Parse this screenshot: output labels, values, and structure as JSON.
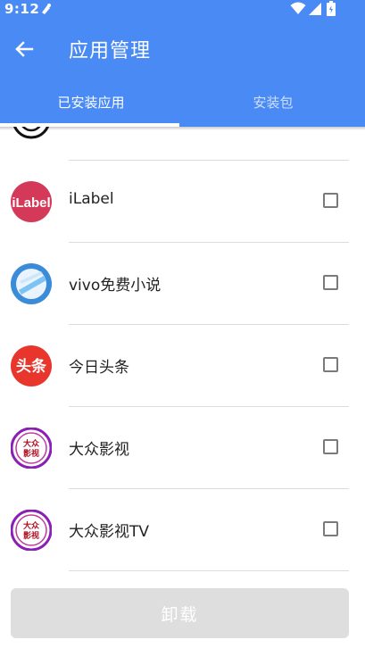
{
  "status_bar": {
    "time": "9:12"
  },
  "header": {
    "title": "应用管理",
    "tabs": [
      {
        "label": "已安装应用",
        "active": true
      },
      {
        "label": "安装包",
        "active": false
      }
    ]
  },
  "apps": [
    {
      "name": "",
      "icon": "ring-app-icon",
      "checked": false
    },
    {
      "name": "iLabel",
      "icon": "ilabel-app-icon",
      "icon_text": "iLabel",
      "checked": false
    },
    {
      "name": "vivo免费小说",
      "icon": "vivo-novel-app-icon",
      "checked": false
    },
    {
      "name": "今日头条",
      "icon": "toutiao-app-icon",
      "icon_text": "头条",
      "checked": false
    },
    {
      "name": "大众影视",
      "icon": "dazhong-app-icon",
      "icon_text": "大众\n影视",
      "checked": false
    },
    {
      "name": "大众影视TV",
      "icon": "dazhong-tv-app-icon",
      "icon_text": "大众\n影视",
      "checked": false
    }
  ],
  "footer": {
    "uninstall_label": "卸载"
  },
  "colors": {
    "primary": "#4a8af4",
    "disabled_button": "#dedede"
  }
}
